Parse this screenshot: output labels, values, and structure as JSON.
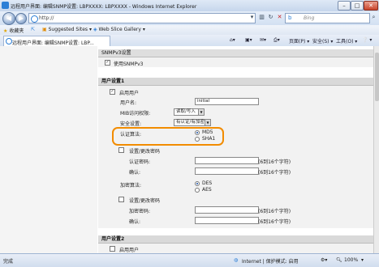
{
  "window": {
    "title": "远程用户界面: 编辑SNMP设置: LBPXXXX: LBPXXXX - Windows Internet Explorer"
  },
  "address_bar": {
    "url": "http://",
    "search_placeholder": "Bing"
  },
  "favorites_bar": {
    "favorites_label": "收藏夹",
    "suggested_sites": "Suggested Sites ▾",
    "web_slice_gallery": "Web Slice Gallery ▾"
  },
  "tab": {
    "title": "远程用户界面: 编辑SNMP设置: LBP..."
  },
  "command_bar": {
    "page_menu": "页面(P) ▾",
    "safety_menu": "安全(S) ▾",
    "tools_menu": "工具(O) ▾",
    "help": "❔ ▾"
  },
  "snmpv3": {
    "header": "SNMPv3设置",
    "use_label": "使用SNMPv3",
    "use_checked": true
  },
  "user1": {
    "header": "用户设置1",
    "enable_label": "启用用户",
    "enable_checked": true,
    "username_label": "用户名:",
    "username_value": "initial",
    "access_label": "MIB访问权限:",
    "access_value": "读取/写入",
    "security_label": "安全设置:",
    "security_value": "有认证/有加密",
    "auth_algo_label": "认证算法:",
    "auth_options": [
      "MD5",
      "SHA1"
    ],
    "auth_selected": "MD5",
    "set_auth_pw_label": "设置/更改密码",
    "auth_pw_label": "认证密码:",
    "auth_pw_hint": "(6到16个字符)",
    "confirm_label": "确认:",
    "confirm_hint": "(6到16个字符)",
    "enc_algo_label": "加密算法:",
    "enc_options": [
      "DES",
      "AES"
    ],
    "enc_selected": "DES",
    "set_enc_pw_label": "设置/更改密码",
    "enc_pw_label": "加密密码:",
    "enc_pw_hint": "(6到16个字符)",
    "enc_confirm_label": "确认:",
    "enc_confirm_hint": "(6到16个字符)"
  },
  "user2": {
    "header": "用户设置2",
    "enable_label": "启用用户",
    "enable_checked": false
  },
  "status_bar": {
    "left": "完成",
    "zone": "Internet | 保护模式: 启用",
    "zoom": "100%"
  },
  "colors": {
    "highlight": "#f28c00",
    "ie_blue": "#2c7fd6"
  }
}
